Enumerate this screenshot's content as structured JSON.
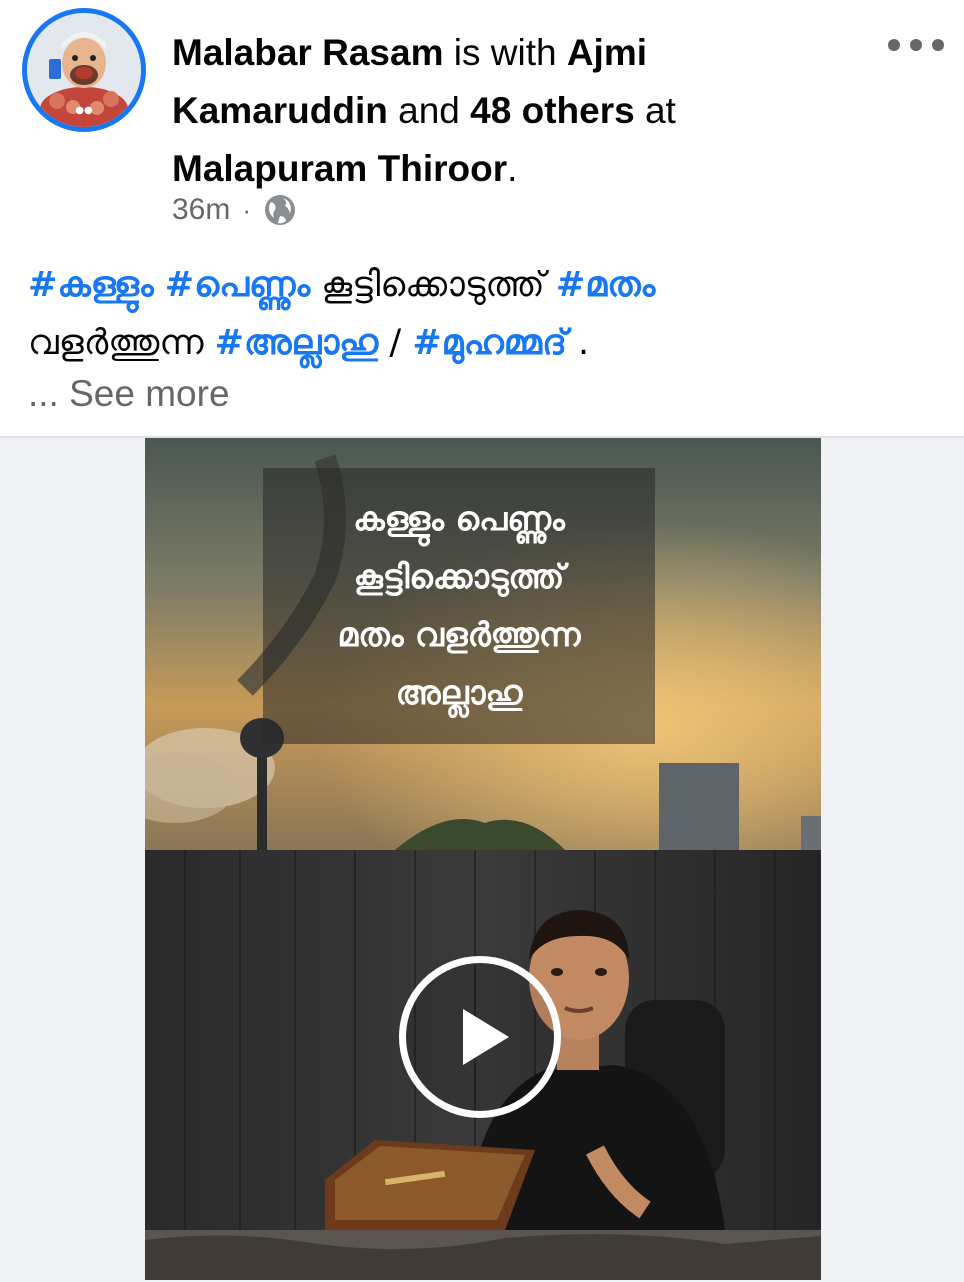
{
  "post": {
    "author": "Malabar Rasam",
    "with_text": " is with ",
    "tagged": "Ajmi Kamaruddin",
    "and_text": " and ",
    "others": "48 others",
    "at_text": " at ",
    "location": "Malapuram Thiroor",
    "period": ".",
    "time": "36m",
    "separator": "·",
    "privacy_icon": "globe-icon",
    "more_icon": "more-options-icon"
  },
  "text": {
    "tag1": "#കള്ളും",
    "tag2": "#പെണ്ണും",
    "plain1": "കൂട്ടിക്കൊടുത്ത്",
    "tag3": "#മതം",
    "plain2": "വളർത്തുന്ന",
    "tag4": "#അല്ലാഹു",
    "slash": "/",
    "tag5": "#മുഹമ്മദ്",
    "end": ".",
    "see_more": "... See more"
  },
  "video": {
    "overlay_lines": [
      "കള്ളും പെണ്ണും",
      "കൂട്ടിക്കൊടുത്ത്",
      "മതം വളർത്തുന്ന",
      "അല്ലാഹു"
    ],
    "play_icon": "play-icon"
  },
  "colors": {
    "link": "#1877f2",
    "secondary_text": "#65676b",
    "primary_text": "#050505"
  }
}
